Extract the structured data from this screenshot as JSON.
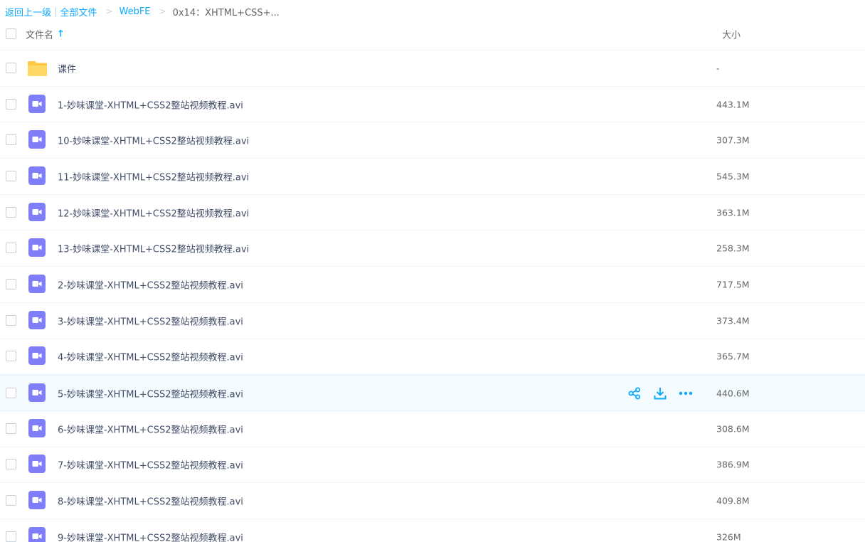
{
  "breadcrumb": {
    "back": "返回上一级",
    "separator": "|",
    "all_files": "全部文件",
    "arrow": ">",
    "folder": "WebFE",
    "current": "0x14：XHTML+CSS+..."
  },
  "header": {
    "name_col": "文件名",
    "size_col": "大小"
  },
  "colors": {
    "accent": "#09aaff",
    "video": "#7f7ef8",
    "folder": "#ffd15c"
  },
  "rows": [
    {
      "type": "folder",
      "icon": "folder-icon",
      "name": "课件",
      "size": "-"
    },
    {
      "type": "video",
      "icon": "video-icon",
      "name": "1-妙味课堂-XHTML+CSS2整站视频教程.avi",
      "size": "443.1M"
    },
    {
      "type": "video",
      "icon": "video-icon",
      "name": "10-妙味课堂-XHTML+CSS2整站视频教程.avi",
      "size": "307.3M"
    },
    {
      "type": "video",
      "icon": "video-icon",
      "name": "11-妙味课堂-XHTML+CSS2整站视频教程.avi",
      "size": "545.3M"
    },
    {
      "type": "video",
      "icon": "video-icon",
      "name": "12-妙味课堂-XHTML+CSS2整站视频教程.avi",
      "size": "363.1M"
    },
    {
      "type": "video",
      "icon": "video-icon",
      "name": "13-妙味课堂-XHTML+CSS2整站视频教程.avi",
      "size": "258.3M"
    },
    {
      "type": "video",
      "icon": "video-icon",
      "name": "2-妙味课堂-XHTML+CSS2整站视频教程.avi",
      "size": "717.5M"
    },
    {
      "type": "video",
      "icon": "video-icon",
      "name": "3-妙味课堂-XHTML+CSS2整站视频教程.avi",
      "size": "373.4M"
    },
    {
      "type": "video",
      "icon": "video-icon",
      "name": "4-妙味课堂-XHTML+CSS2整站视频教程.avi",
      "size": "365.7M"
    },
    {
      "type": "video",
      "icon": "video-icon",
      "name": "5-妙味课堂-XHTML+CSS2整站视频教程.avi",
      "size": "440.6M",
      "hover": true
    },
    {
      "type": "video",
      "icon": "video-icon",
      "name": "6-妙味课堂-XHTML+CSS2整站视频教程.avi",
      "size": "308.6M"
    },
    {
      "type": "video",
      "icon": "video-icon",
      "name": "7-妙味课堂-XHTML+CSS2整站视频教程.avi",
      "size": "386.9M"
    },
    {
      "type": "video",
      "icon": "video-icon",
      "name": "8-妙味课堂-XHTML+CSS2整站视频教程.avi",
      "size": "409.8M"
    },
    {
      "type": "video",
      "icon": "video-icon",
      "name": "9-妙味课堂-XHTML+CSS2整站视频教程.avi",
      "size": "326M"
    }
  ],
  "hover_actions": [
    "share-icon",
    "download-icon",
    "more-icon"
  ]
}
